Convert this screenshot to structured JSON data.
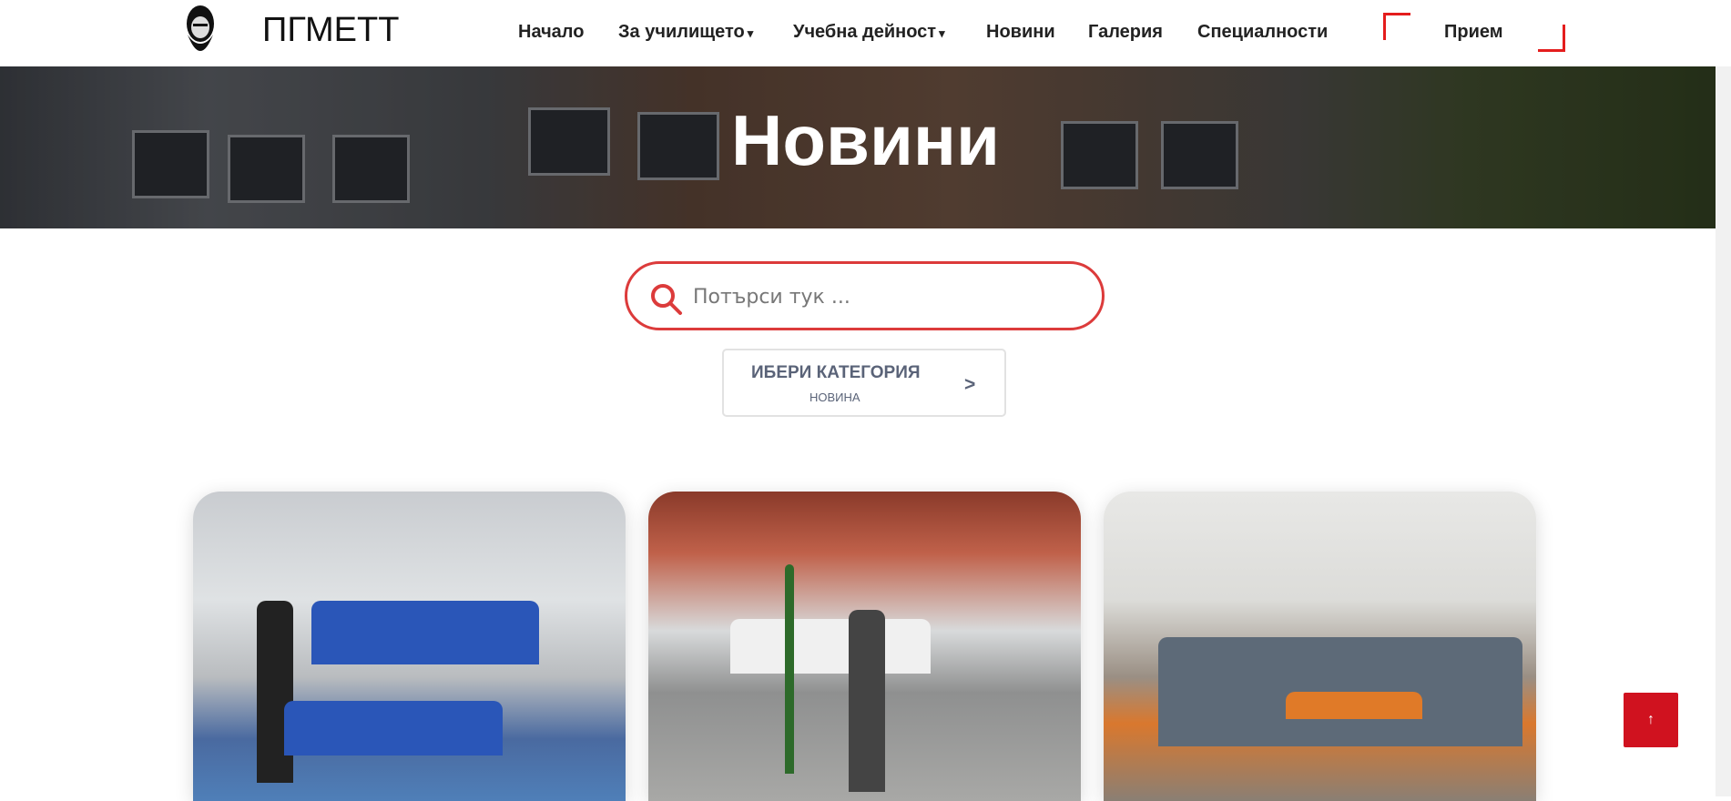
{
  "header": {
    "brand": "ПГМЕТТ",
    "menu": [
      "Начало",
      "За училището",
      "Учебна дейност",
      "Новини",
      "Галерия",
      "Специалности"
    ],
    "cta": "Прием",
    "caret": "▾"
  },
  "hero": {
    "title": "Новини"
  },
  "search": {
    "placeholder": "Потърси тук ..."
  },
  "category": {
    "label": "ИБЕРИ КАТЕГОРИЯ",
    "value": "НОВИНА",
    "arrow": ">"
  },
  "back_to_top": {
    "label": "↑"
  },
  "colors": {
    "accent": "#dc3b3b",
    "button": "#d0121f"
  }
}
